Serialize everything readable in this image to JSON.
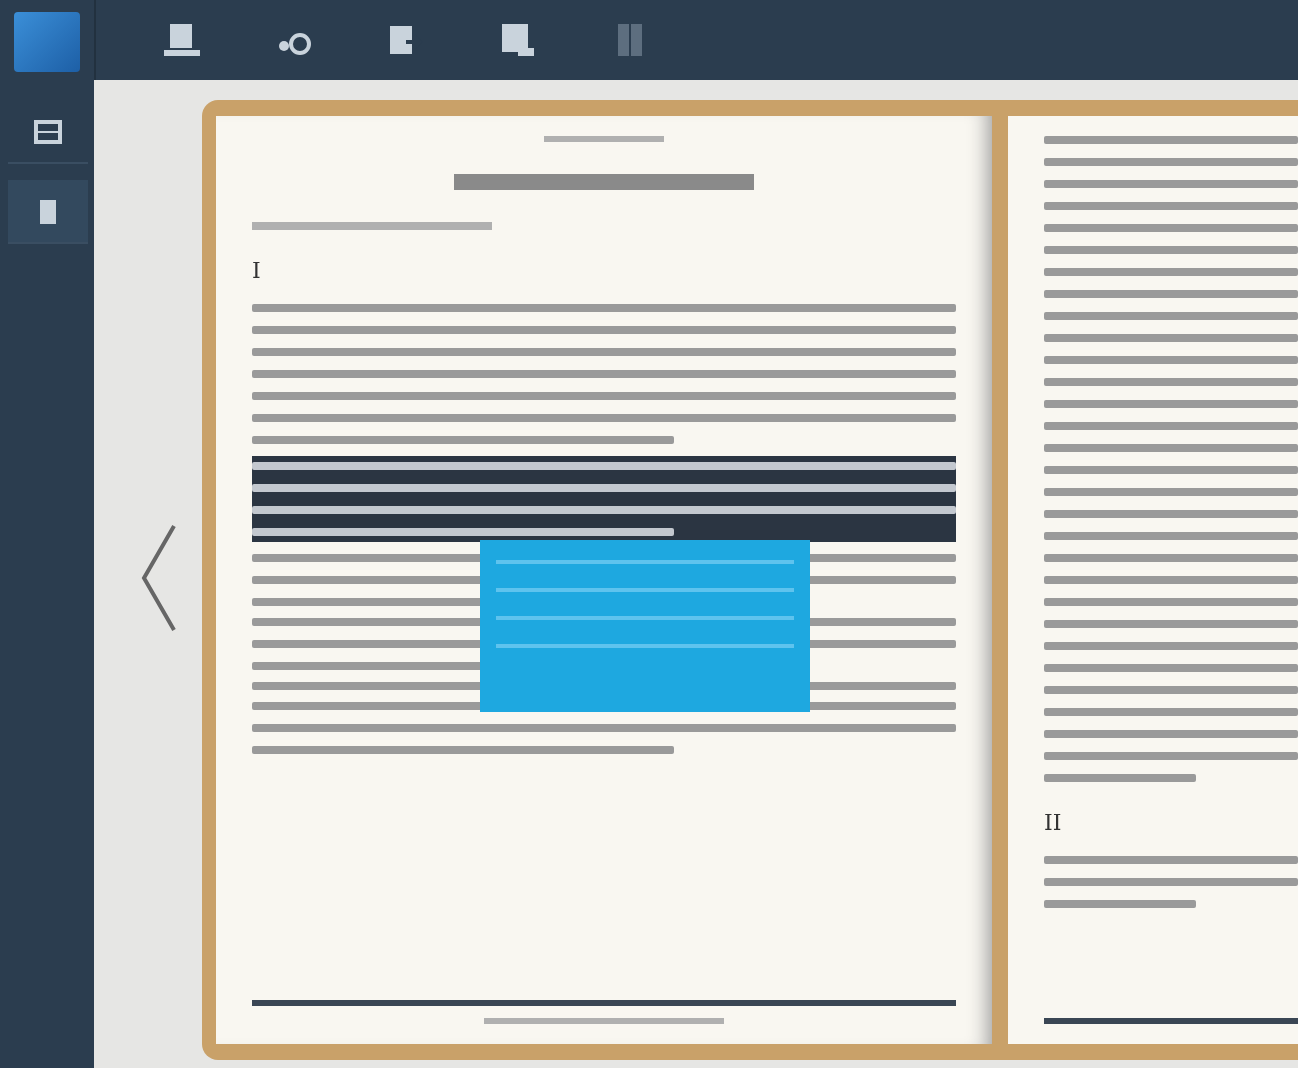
{
  "toolbar": {
    "items": [
      {
        "kind": "library"
      },
      {
        "kind": "brightness"
      },
      {
        "kind": "export"
      },
      {
        "kind": "download"
      },
      {
        "kind": "columns"
      }
    ]
  },
  "sidebar": {
    "items": [
      {
        "kind": "grid",
        "selected": false
      },
      {
        "kind": "bookmark",
        "selected": true
      }
    ]
  },
  "book": {
    "left_page": {
      "chapter": "I",
      "blocks": [
        {
          "kind": "paragraph",
          "highlighted": false
        },
        {
          "kind": "paragraph",
          "highlighted": true
        },
        {
          "kind": "paragraph",
          "highlighted": false
        },
        {
          "kind": "paragraph",
          "highlighted": false
        },
        {
          "kind": "paragraph",
          "highlighted": false
        },
        {
          "kind": "paragraph",
          "highlighted": false
        }
      ]
    },
    "right_page": {
      "chapter": "II"
    }
  },
  "popup": {
    "kind": "selection-menu"
  }
}
